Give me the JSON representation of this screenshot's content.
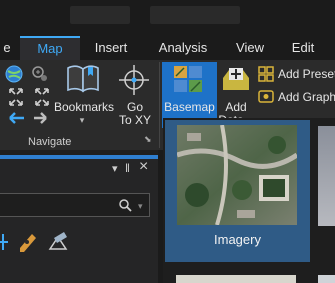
{
  "ribbon_tabs": [
    {
      "label": "e",
      "active": false
    },
    {
      "label": "Map",
      "active": true
    },
    {
      "label": "Insert",
      "active": false
    },
    {
      "label": "Analysis",
      "active": false
    },
    {
      "label": "View",
      "active": false
    },
    {
      "label": "Edit",
      "active": false
    }
  ],
  "ribbon": {
    "bookmarks_label": "Bookmarks",
    "goto_line1": "Go",
    "goto_line2": "To XY",
    "basemap_label": "Basemap",
    "add_data_line1": "Add",
    "add_data_line2": "Data",
    "add_preset_label": "Add Preset",
    "add_graphics_label": "Add Graphic",
    "navigate_group_label": "Navigate"
  },
  "pane": {
    "pin_glyph": "‖",
    "close_glyph": "×",
    "menu_glyph": "▾"
  },
  "gallery": {
    "items": [
      {
        "label": "Imagery",
        "selected": true
      }
    ]
  },
  "colors": {
    "accent": "#3fa9f5",
    "selected_button": "#1e72c8",
    "selected_tile": "#2f5b86",
    "ribbon_bg": "#2b2b2b"
  }
}
